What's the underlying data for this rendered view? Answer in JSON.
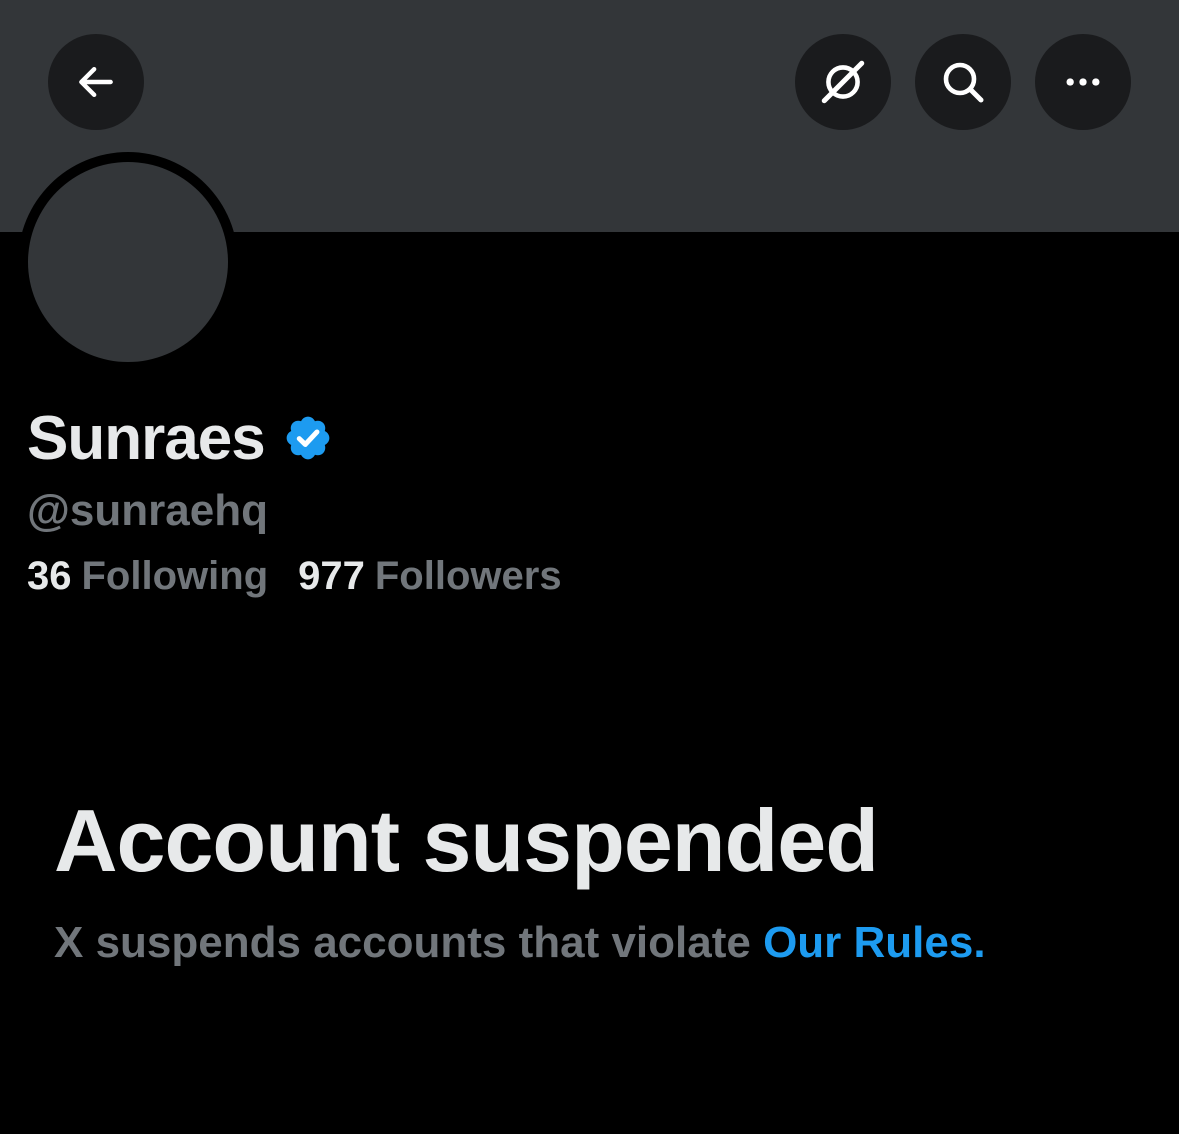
{
  "header": {
    "back_icon": "arrow-left-icon",
    "grok_icon": "grok-slash-icon",
    "search_icon": "search-icon",
    "more_icon": "more-horizontal-icon"
  },
  "profile": {
    "display_name": "Sunraes",
    "verified_icon": "verified-badge-icon",
    "handle": "@sunraehq",
    "following_count": "36",
    "following_label": "Following",
    "followers_count": "977",
    "followers_label": "Followers"
  },
  "notice": {
    "title": "Account suspended",
    "description": "X suspends accounts that violate ",
    "link_text": "Our Rules",
    "trailing": "."
  },
  "colors": {
    "background": "#000000",
    "banner": "#333639",
    "text_primary": "#e7e9ea",
    "text_secondary": "#71767b",
    "link": "#1d9bf0",
    "verified": "#1d9bf0"
  }
}
